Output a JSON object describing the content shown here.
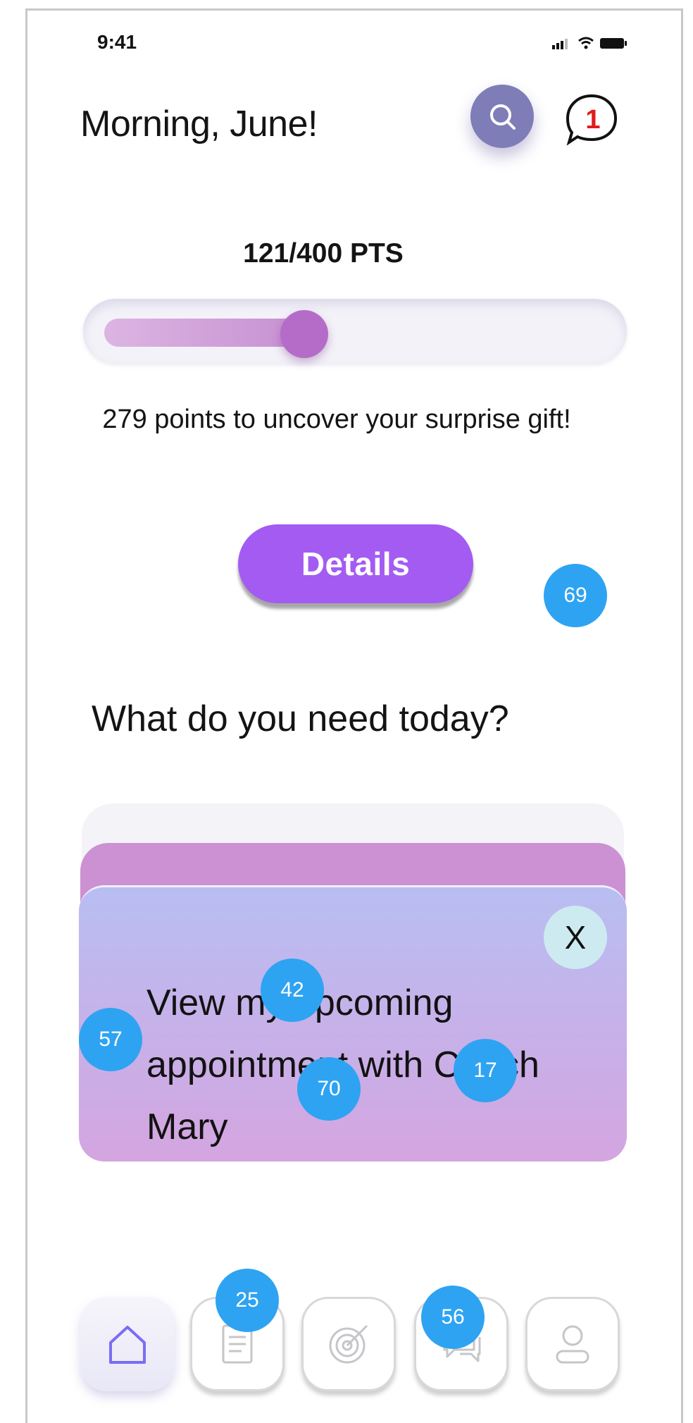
{
  "status_bar": {
    "time": "9:41",
    "icons": [
      "signal-icon",
      "wifi-icon",
      "battery-icon"
    ]
  },
  "header": {
    "greeting": "Morning, June!",
    "search_icon": "search-icon",
    "notification_icon": "chat-bubble-icon",
    "notification_count": "1"
  },
  "rewards": {
    "points_label": "121/400 PTS",
    "progress_fraction": 0.3025,
    "message": "279 points to uncover your surprise gift!",
    "details_label": "Details"
  },
  "section": {
    "title": "What do you need today?"
  },
  "card": {
    "text": "View my upcoming appointment with Coach Mary",
    "close_label": "X"
  },
  "badges": [
    "69",
    "42",
    "57",
    "70",
    "17",
    "25",
    "56"
  ],
  "bottom_nav": [
    {
      "name": "home",
      "icon": "home-icon",
      "active": true
    },
    {
      "name": "documents",
      "icon": "document-icon",
      "active": false
    },
    {
      "name": "goals",
      "icon": "target-icon",
      "active": false
    },
    {
      "name": "messages",
      "icon": "chat-icon",
      "active": false
    },
    {
      "name": "profile",
      "icon": "profile-icon",
      "active": false
    }
  ],
  "colors": {
    "accent": "#a45bf2",
    "progress": "#b56cc9",
    "search_bg": "#7f7db7",
    "badge": "#2ea3f2",
    "home_icon": "#7b6cf6"
  }
}
